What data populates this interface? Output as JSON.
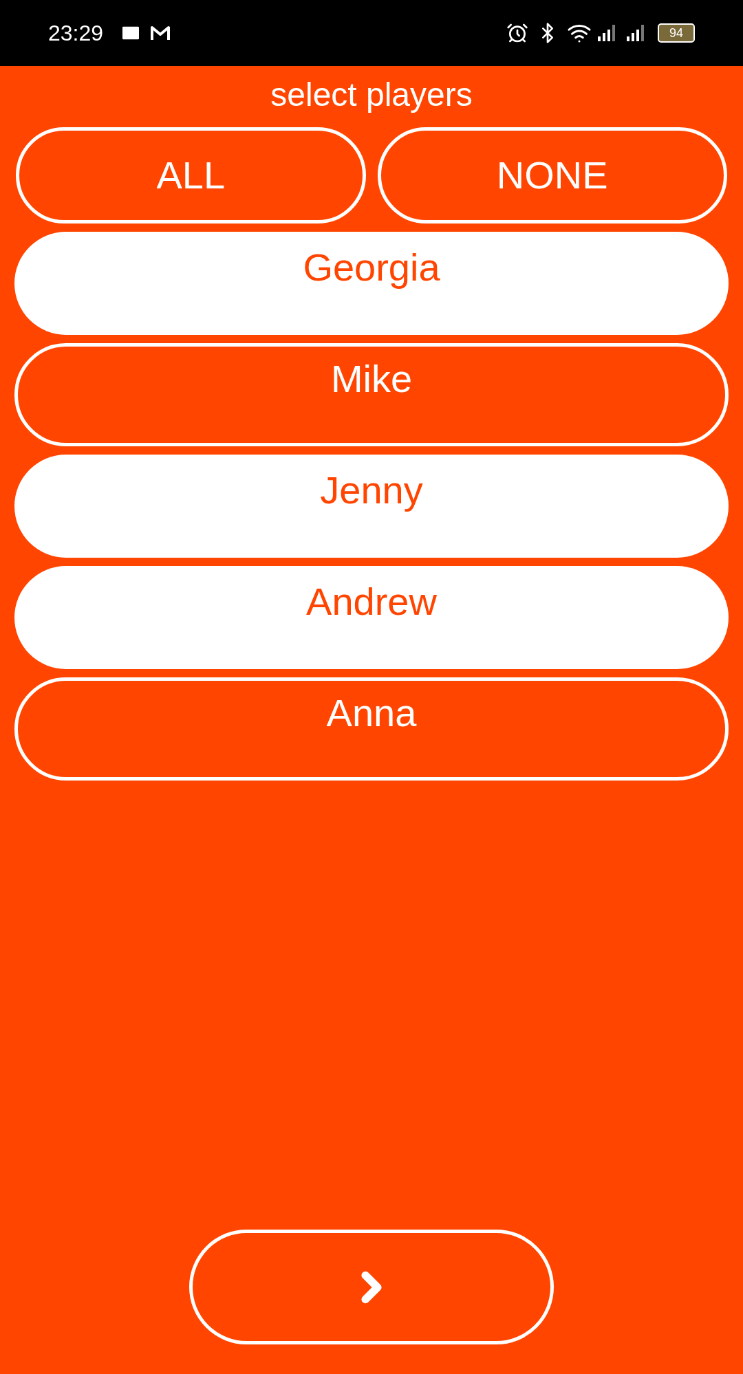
{
  "status_bar": {
    "time": "23:29",
    "battery": "94"
  },
  "title": "select players",
  "bulk_buttons": [
    "ALL",
    "NONE"
  ],
  "players": [
    {
      "name": "Georgia",
      "selected": true
    },
    {
      "name": "Mike",
      "selected": false
    },
    {
      "name": "Jenny",
      "selected": true
    },
    {
      "name": "Andrew",
      "selected": true
    },
    {
      "name": "Anna",
      "selected": false
    }
  ]
}
